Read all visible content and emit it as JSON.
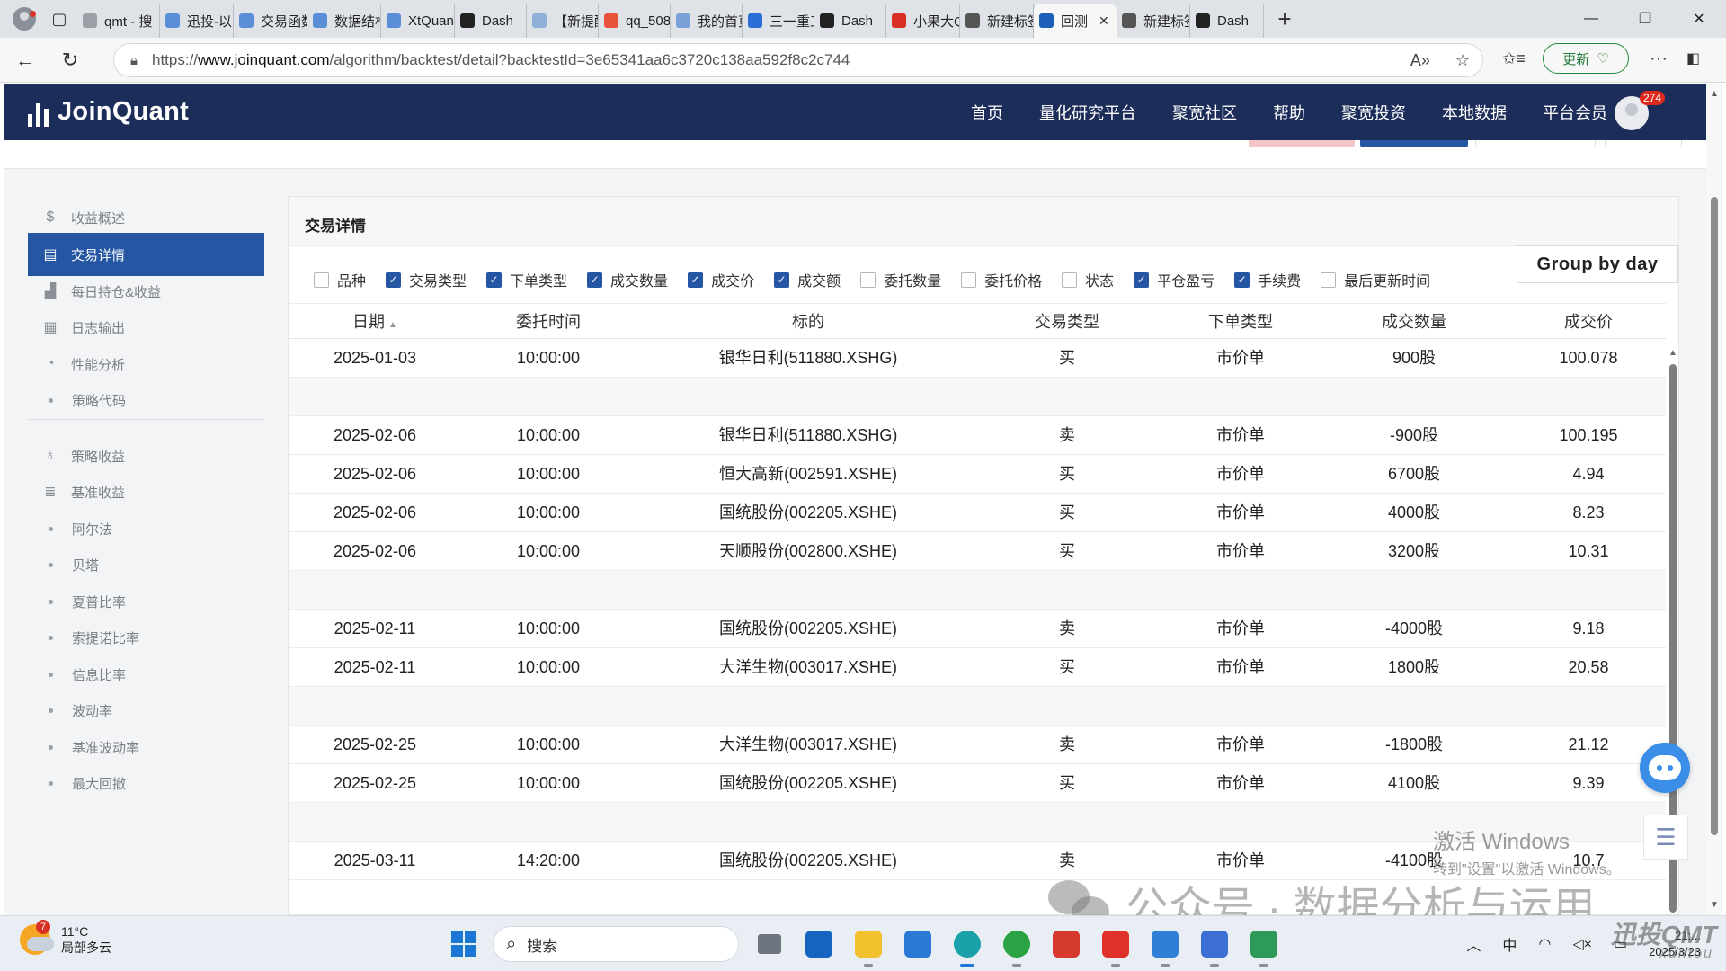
{
  "browser": {
    "tabs": [
      {
        "label": "qmt - 搜",
        "color": "#9aa0a6"
      },
      {
        "label": "迅投-以",
        "color": "#5a8fd8"
      },
      {
        "label": "交易函数",
        "color": "#5a8fd8"
      },
      {
        "label": "数据结构",
        "color": "#5a8fd8"
      },
      {
        "label": "XtQuant",
        "color": "#5a8fd8"
      },
      {
        "label": "Dash",
        "color": "#222222"
      },
      {
        "label": "【新提醒",
        "color": "#8fb1d9"
      },
      {
        "label": "qq_5088",
        "color": "#e8513a"
      },
      {
        "label": "我的首页",
        "color": "#7aa2d8"
      },
      {
        "label": "三一重工",
        "color": "#2a6fd8"
      },
      {
        "label": "Dash",
        "color": "#222222"
      },
      {
        "label": "小果大Q",
        "color": "#d93025"
      },
      {
        "label": "新建标签",
        "color": "#555555"
      },
      {
        "label": "回测",
        "color": "#1c5fb8",
        "active": true
      },
      {
        "label": "新建标签",
        "color": "#555555"
      },
      {
        "label": "Dash",
        "color": "#222222"
      }
    ],
    "url_prefix": "https://",
    "url_host": "www.joinquant.com",
    "url_path": "/algorithm/backtest/detail?backtestId=3e65341aa6c3720c138aa592f8c2c744",
    "update_label": "更新"
  },
  "site": {
    "logo": "JoinQuant",
    "nav": [
      "首页",
      "量化研究平台",
      "聚宽社区",
      "帮助",
      "聚宽投资",
      "本地数据",
      "平台会员"
    ],
    "badge": "274"
  },
  "sidebar": {
    "items": [
      {
        "label": "收益概述",
        "icon": "dollar-icon"
      },
      {
        "label": "交易详情",
        "icon": "document-icon",
        "active": true
      },
      {
        "label": "每日持仓&收益",
        "icon": "bar-chart-icon"
      },
      {
        "label": "日志输出",
        "icon": "calendar-icon"
      },
      {
        "label": "性能分析",
        "icon": "pie-icon"
      },
      {
        "label": "策略代码",
        "icon": "dot"
      },
      {
        "label": "策略收益",
        "icon": "bulb-icon"
      },
      {
        "label": "基准收益",
        "icon": "database-icon"
      },
      {
        "label": "阿尔法",
        "icon": "dot"
      },
      {
        "label": "贝塔",
        "icon": "dot"
      },
      {
        "label": "夏普比率",
        "icon": "dot"
      },
      {
        "label": "索提诺比率",
        "icon": "dot"
      },
      {
        "label": "信息比率",
        "icon": "dot"
      },
      {
        "label": "波动率",
        "icon": "dot"
      },
      {
        "label": "基准波动率",
        "icon": "dot"
      },
      {
        "label": "最大回撤",
        "icon": "dot"
      }
    ]
  },
  "panel": {
    "title": "交易详情",
    "group_button": "Group by day",
    "filters": [
      {
        "label": "品种",
        "checked": false
      },
      {
        "label": "交易类型",
        "checked": true
      },
      {
        "label": "下单类型",
        "checked": true
      },
      {
        "label": "成交数量",
        "checked": true
      },
      {
        "label": "成交价",
        "checked": true
      },
      {
        "label": "成交额",
        "checked": true
      },
      {
        "label": "委托数量",
        "checked": false
      },
      {
        "label": "委托价格",
        "checked": false
      },
      {
        "label": "状态",
        "checked": false
      },
      {
        "label": "平仓盈亏",
        "checked": true
      },
      {
        "label": "手续费",
        "checked": true
      },
      {
        "label": "最后更新时间",
        "checked": false
      }
    ],
    "columns": [
      "日期",
      "委托时间",
      "标的",
      "交易类型",
      "下单类型",
      "成交数量",
      "成交价"
    ],
    "rows": [
      {
        "date": "2025-01-03",
        "time": "10:00:00",
        "symbol": "银华日利(511880.XSHG)",
        "side": "买",
        "order": "市价单",
        "qty": "900股",
        "price": "100.078"
      },
      {
        "gap": true
      },
      {
        "date": "2025-02-06",
        "time": "10:00:00",
        "symbol": "银华日利(511880.XSHG)",
        "side": "卖",
        "order": "市价单",
        "qty": "-900股",
        "price": "100.195"
      },
      {
        "date": "2025-02-06",
        "time": "10:00:00",
        "symbol": "恒大高新(002591.XSHE)",
        "side": "买",
        "order": "市价单",
        "qty": "6700股",
        "price": "4.94"
      },
      {
        "date": "2025-02-06",
        "time": "10:00:00",
        "symbol": "国统股份(002205.XSHE)",
        "side": "买",
        "order": "市价单",
        "qty": "4000股",
        "price": "8.23"
      },
      {
        "date": "2025-02-06",
        "time": "10:00:00",
        "symbol": "天顺股份(002800.XSHE)",
        "side": "买",
        "order": "市价单",
        "qty": "3200股",
        "price": "10.31"
      },
      {
        "gap": true
      },
      {
        "date": "2025-02-11",
        "time": "10:00:00",
        "symbol": "国统股份(002205.XSHE)",
        "side": "卖",
        "order": "市价单",
        "qty": "-4000股",
        "price": "9.18"
      },
      {
        "date": "2025-02-11",
        "time": "10:00:00",
        "symbol": "大洋生物(003017.XSHE)",
        "side": "买",
        "order": "市价单",
        "qty": "1800股",
        "price": "20.58"
      },
      {
        "gap": true
      },
      {
        "date": "2025-02-25",
        "time": "10:00:00",
        "symbol": "大洋生物(003017.XSHE)",
        "side": "卖",
        "order": "市价单",
        "qty": "-1800股",
        "price": "21.12"
      },
      {
        "date": "2025-02-25",
        "time": "10:00:00",
        "symbol": "国统股份(002205.XSHE)",
        "side": "买",
        "order": "市价单",
        "qty": "4100股",
        "price": "9.39"
      },
      {
        "gap": true
      },
      {
        "date": "2025-03-11",
        "time": "14:20:00",
        "symbol": "国统股份(002205.XSHE)",
        "side": "卖",
        "order": "市价单",
        "qty": "-4100股",
        "price": "10.7"
      }
    ]
  },
  "overlay": {
    "activate_title": "激活 Windows",
    "activate_sub": "转到\"设置\"以激活 Windows。",
    "watermark": "公众号 · 数据分析与运用",
    "corner_mark": "迅投QMT",
    "corner_mark_sub": "xuntou"
  },
  "taskbar": {
    "weather_temp": "11°C",
    "weather_desc": "局部多云",
    "weather_badge": "7",
    "search": "搜索",
    "ime": "中",
    "date": "2025/3/23",
    "time": "21:..."
  }
}
